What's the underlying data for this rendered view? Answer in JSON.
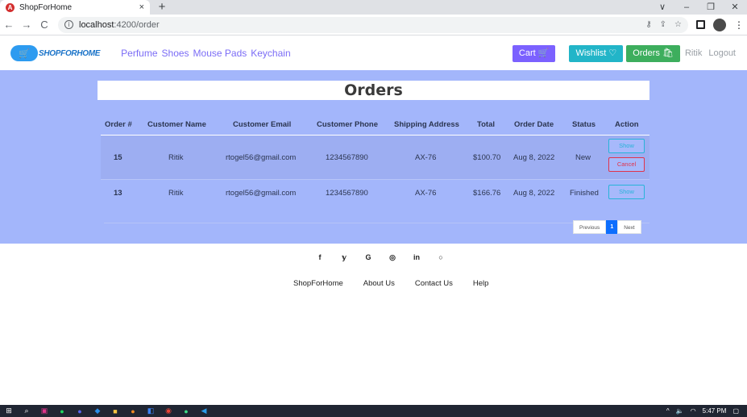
{
  "browser": {
    "tab_title": "ShopForHome",
    "tab_close": "×",
    "new_tab": "+",
    "url_host": "localhost",
    "url_path": ":4200/order",
    "window_controls": [
      "∨",
      "–",
      "❐",
      "✕"
    ],
    "nav": {
      "back": "←",
      "forward": "→",
      "reload": "C"
    }
  },
  "app_nav": {
    "logo_text": "SHOPFORHOME",
    "links": [
      "Perfume",
      "Shoes",
      "Mouse Pads",
      "Keychain"
    ],
    "cart_label": "Cart",
    "wishlist_label": "Wishlist",
    "orders_label": "Orders",
    "user_name": "Ritik",
    "logout_label": "Logout"
  },
  "orders": {
    "title": "Orders",
    "columns": [
      "Order #",
      "Customer Name",
      "Customer Email",
      "Customer Phone",
      "Shipping Address",
      "Total",
      "Order Date",
      "Status",
      "Action"
    ],
    "rows": [
      {
        "order_no": "15",
        "name": "Ritik",
        "email": "rtogel56@gmail.com",
        "phone": "1234567890",
        "address": "AX-76",
        "total": "$100.70",
        "date": "Aug 8, 2022",
        "status": "New",
        "show_label": "Show",
        "cancel_label": "Cancel"
      },
      {
        "order_no": "13",
        "name": "Ritik",
        "email": "rtogel56@gmail.com",
        "phone": "1234567890",
        "address": "AX-76",
        "total": "$166.76",
        "date": "Aug 8, 2022",
        "status": "Finished",
        "show_label": "Show"
      }
    ],
    "pagination": {
      "prev": "Previous",
      "page": "1",
      "next": "Next"
    }
  },
  "footer": {
    "social_icons": [
      "f",
      "𝕪",
      "G",
      "◎",
      "in",
      "○"
    ],
    "links": [
      "ShopForHome",
      "About Us",
      "Contact Us",
      "Help"
    ]
  },
  "taskbar": {
    "time": "5:47 PM"
  },
  "colors": {
    "orders_bg": "#a3b6fb",
    "cart_btn": "#7b61ff",
    "wishlist_btn": "#22b5c8",
    "orders_btn": "#3dae5d"
  }
}
